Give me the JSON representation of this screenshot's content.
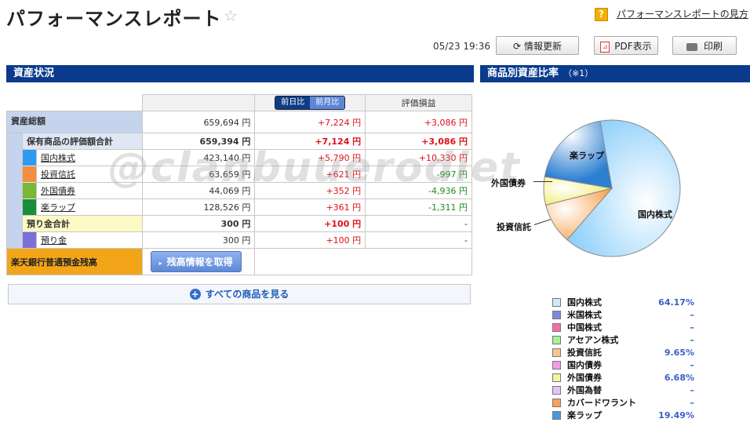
{
  "header": {
    "title": "パフォーマンスレポート",
    "help_link": "パフォーマンスレポートの見方",
    "timestamp": "05/23 19:36",
    "refresh_label": "情報更新",
    "pdf_label": "PDF表示",
    "print_label": "印刷"
  },
  "sections": {
    "asset_status": "資産状況",
    "ratio_title": "商品別資産比率",
    "ratio_note": "（※1）"
  },
  "table": {
    "tab_day": "前日比",
    "tab_month": "前月比",
    "col_gain": "評価損益",
    "total": {
      "label": "資産総額",
      "value": "659,694 円",
      "change": "+7,224 円",
      "gain": "+3,086 円"
    },
    "holdings_total": {
      "label": "保有商品の評価額合計",
      "value": "659,394 円",
      "change": "+7,124 円",
      "gain": "+3,086 円"
    },
    "holdings": [
      {
        "label": "国内株式",
        "color": "#2f9bef",
        "value": "423,140 円",
        "change": "+5,790 円",
        "gain": "+10,330 円",
        "gain_sign": "pos"
      },
      {
        "label": "投資信託",
        "color": "#f48d3d",
        "value": "63,659 円",
        "change": "+621 円",
        "gain": "-997 円",
        "gain_sign": "neg"
      },
      {
        "label": "外国債券",
        "color": "#79b739",
        "value": "44,069 円",
        "change": "+352 円",
        "gain": "-4,936 円",
        "gain_sign": "neg"
      },
      {
        "label": "楽ラップ",
        "color": "#1a8e3c",
        "value": "128,526 円",
        "change": "+361 円",
        "gain": "-1,311 円",
        "gain_sign": "neg"
      }
    ],
    "deposit_total": {
      "label": "預り金合計",
      "value": "300 円",
      "change": "+100 円",
      "gain": "-"
    },
    "deposit": {
      "label": "預り金",
      "color": "#7b6fd9",
      "value": "300 円",
      "change": "+100 円",
      "gain": "-"
    },
    "bank": {
      "label": "楽天銀行普通預金残高",
      "button": "残高情報を取得"
    },
    "see_all": "すべての商品を見る"
  },
  "watermark": "@clanbuuerodiet",
  "chart_data": {
    "type": "pie",
    "slices": [
      {
        "name": "国内株式",
        "value": 64.17,
        "color": "#a8dcfb"
      },
      {
        "name": "投資信託",
        "value": 9.65,
        "color": "#f9c17d"
      },
      {
        "name": "外国債券",
        "value": 6.68,
        "color": "#f7f29d"
      },
      {
        "name": "楽ラップ",
        "value": 19.49,
        "color": "#3b8fdb"
      }
    ],
    "labels": [
      "楽ラップ",
      "外国債券",
      "投資信託",
      "国内株式"
    ]
  },
  "legend": [
    {
      "name": "国内株式",
      "value": "64.17%",
      "color": "#cfeafd"
    },
    {
      "name": "米国株式",
      "value": "–",
      "color": "#7a8bd9"
    },
    {
      "name": "中国株式",
      "value": "–",
      "color": "#f26fa6"
    },
    {
      "name": "アセアン株式",
      "value": "–",
      "color": "#a6ef9c"
    },
    {
      "name": "投資信託",
      "value": "9.65%",
      "color": "#f8c78d"
    },
    {
      "name": "国内債券",
      "value": "–",
      "color": "#f29ae8"
    },
    {
      "name": "外国債券",
      "value": "6.68%",
      "color": "#f7f29d"
    },
    {
      "name": "外国為替",
      "value": "–",
      "color": "#e9c2f5"
    },
    {
      "name": "カバードワラント",
      "value": "–",
      "color": "#f2a25d"
    },
    {
      "name": "楽ラップ",
      "value": "19.49%",
      "color": "#4a98df"
    }
  ]
}
